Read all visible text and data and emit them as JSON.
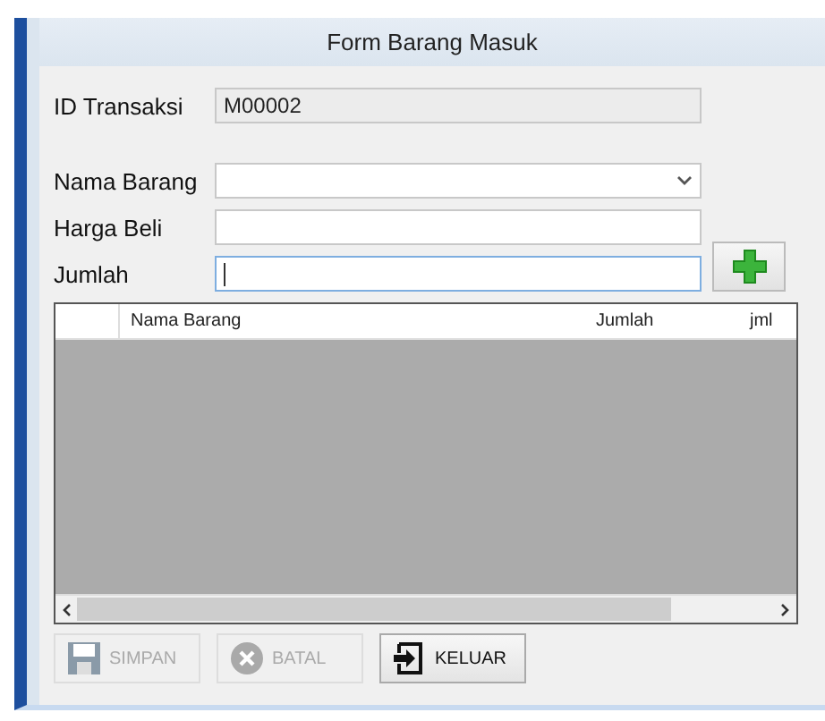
{
  "window": {
    "title": "Form Barang Masuk"
  },
  "fields": [
    {
      "label": "ID Transaksi",
      "kind": "text",
      "value": "M00002",
      "disabled": true,
      "focused": false
    },
    {
      "label": "Nama Barang",
      "kind": "combo",
      "disabled": false,
      "focused": false
    },
    {
      "label": "Harga Beli",
      "kind": "text",
      "disabled": false,
      "focused": false
    },
    {
      "label": "Jumlah",
      "kind": "text",
      "disabled": false,
      "focused": true
    }
  ],
  "grid": {
    "columns": [
      "Nama Barang",
      "Jumlah",
      "jml"
    ]
  },
  "buttons": [
    {
      "label": "SIMPAN",
      "kind": "save",
      "disabled": true
    },
    {
      "label": "BATAL",
      "kind": "cancel",
      "disabled": true
    },
    {
      "label": "KELUAR",
      "kind": "exit",
      "disabled": false
    }
  ]
}
